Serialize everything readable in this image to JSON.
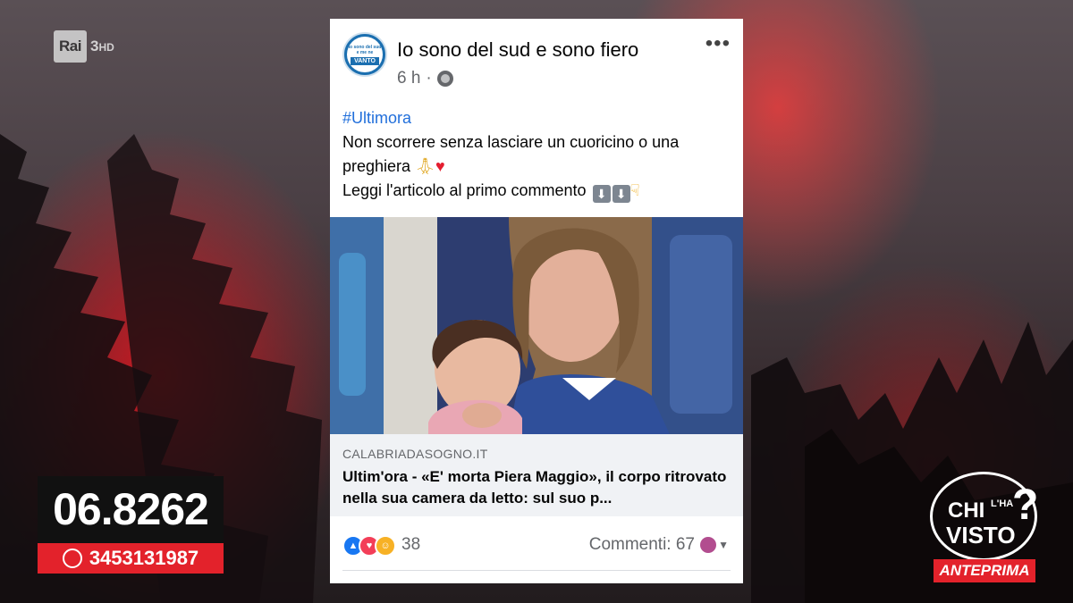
{
  "channel": {
    "name": "Rai",
    "number": "3",
    "suffix": "HD"
  },
  "post": {
    "page_name": "Io sono del sud e sono fiero",
    "avatar_text": "Io sono del sud e me ne",
    "avatar_badge": "VANTO",
    "time": "6 h",
    "separator": "·",
    "more_label": "•••",
    "hashtag": "#Ultimora",
    "line1": "Non scorrere senza lasciare un cuoricino o una preghiera",
    "line2": "Leggi l'articolo al primo commento",
    "link": {
      "domain": "CALABRIADASOGNO.IT",
      "title": "Ultim'ora - «E' morta Piera Maggio», il corpo ritrovato nella sua camera da letto: sul suo p..."
    },
    "reaction_count": "38",
    "comments_label": "Commenti: 67"
  },
  "phone": {
    "number": "06.8262",
    "whatsapp": "3453131987"
  },
  "show": {
    "line1": "CHI",
    "line1_small": "L'HA",
    "line2": "VISTO",
    "question": "?",
    "band": "ANTEPRIMA"
  },
  "colors": {
    "accent_red": "#e3222b",
    "link_blue": "#216fdb",
    "fb_blue": "#1877f2"
  }
}
